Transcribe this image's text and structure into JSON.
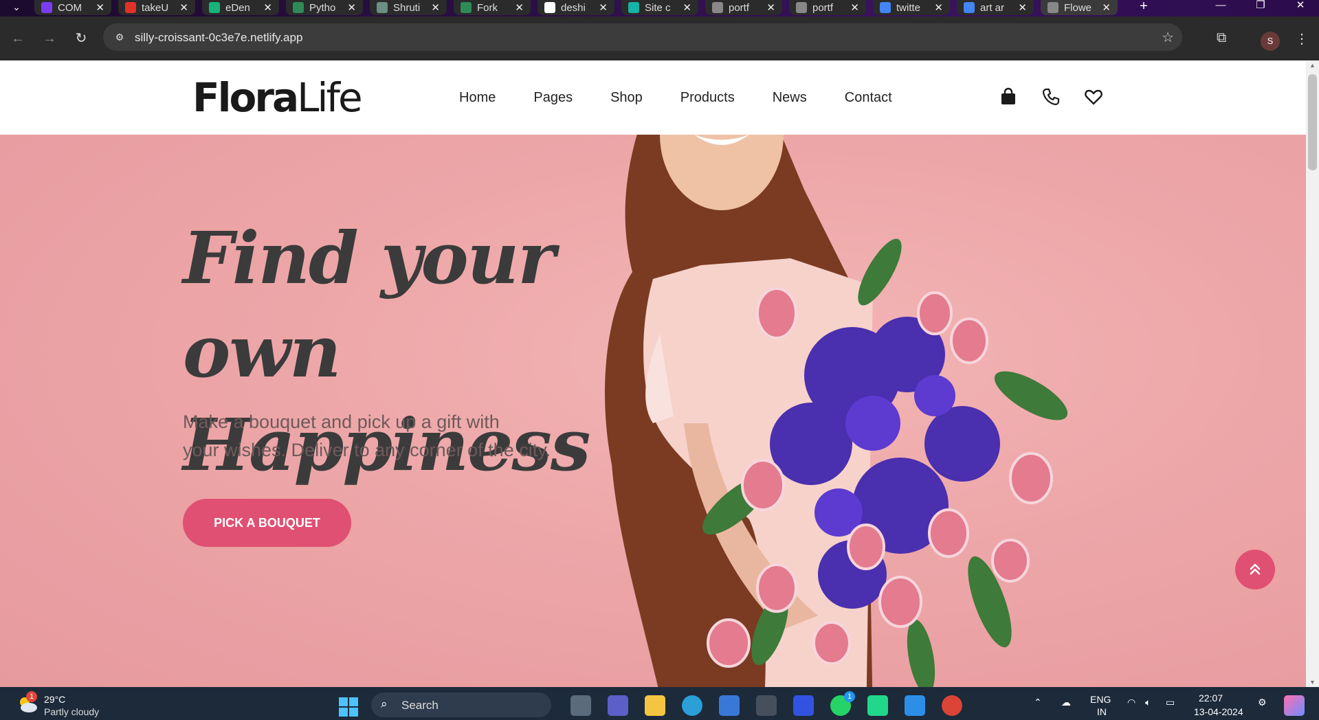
{
  "browser": {
    "tabs": [
      {
        "label": "COM",
        "favicon_color": "#7b3cf0",
        "active": false
      },
      {
        "label": "takeU",
        "favicon_color": "#e0312b",
        "active": false
      },
      {
        "label": "eDen",
        "favicon_color": "#18b37a",
        "active": false
      },
      {
        "label": "Pytho",
        "favicon_color": "#2e8b57",
        "active": false
      },
      {
        "label": "Shruti",
        "favicon_color": "#6b8e85",
        "active": false
      },
      {
        "label": "Fork",
        "favicon_color": "#2e8b57",
        "active": false
      },
      {
        "label": "deshi",
        "favicon_color": "#ffffff",
        "active": false
      },
      {
        "label": "Site c",
        "favicon_color": "#16b3a8",
        "active": false
      },
      {
        "label": "portf",
        "favicon_color": "#888888",
        "active": false
      },
      {
        "label": "portf",
        "favicon_color": "#888888",
        "active": false
      },
      {
        "label": "twitte",
        "favicon_color": "#4285f4",
        "active": false
      },
      {
        "label": "art ar",
        "favicon_color": "#4285f4",
        "active": false
      },
      {
        "label": "Flowe",
        "favicon_color": "#888888",
        "active": true
      }
    ],
    "tab_close_glyph": "✕",
    "new_tab_glyph": "+",
    "url": "silly-croissant-0c3e7e.netlify.app",
    "profile_initial": "S"
  },
  "site": {
    "logo_bold": "Flora",
    "logo_light": "Life",
    "nav": [
      "Home",
      "Pages",
      "Shop",
      "Products",
      "News",
      "Contact"
    ],
    "header_icons": [
      "shopping-bag-icon",
      "phone-icon",
      "heart-icon"
    ],
    "hero": {
      "title_line1": "Find your own",
      "title_line2": "Happiness",
      "subtitle_line1": "Make a bouquet and pick up a gift with",
      "subtitle_line2": "your wishes. Deliver to any corner of the city.",
      "cta": "PICK A BOUQUET"
    },
    "accent_color": "#e05073",
    "hero_bg_color": "#eda6a8"
  },
  "taskbar": {
    "weather_temp": "29°C",
    "weather_desc": "Partly cloudy",
    "weather_badge": "1",
    "search_placeholder": "Search",
    "lang_top": "ENG",
    "lang_bottom": "IN",
    "time": "22:07",
    "date": "13-04-2024",
    "whatsapp_badge": "1"
  }
}
